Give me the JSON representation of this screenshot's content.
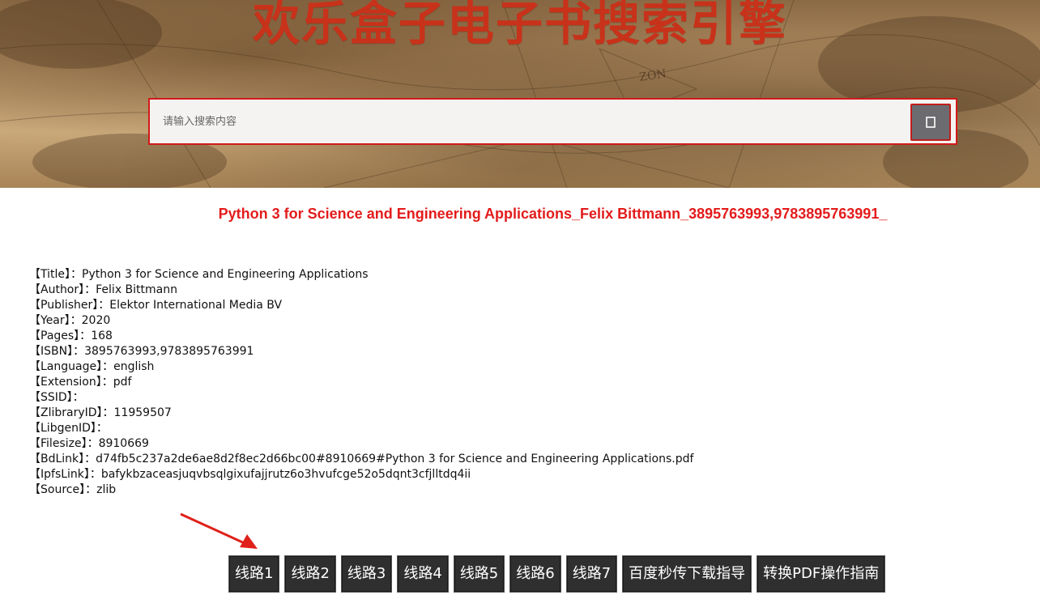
{
  "header": {
    "site_title": "欢乐盒子电子书搜索引擎",
    "search_placeholder": "请输入搜索内容",
    "search_icon": "search-icon"
  },
  "book": {
    "heading": "Python 3 for Science and Engineering Applications_Felix Bittmann_3895763993,9783895763991_",
    "details": [
      {
        "label": "【Title】：",
        "value": "Python 3 for Science and Engineering Applications"
      },
      {
        "label": "【Author】：",
        "value": "Felix Bittmann"
      },
      {
        "label": "【Publisher】：",
        "value": "Elektor International Media BV"
      },
      {
        "label": "【Year】：",
        "value": "2020"
      },
      {
        "label": "【Pages】：",
        "value": "168"
      },
      {
        "label": "【ISBN】：",
        "value": "3895763993,9783895763991"
      },
      {
        "label": "【Language】：",
        "value": "english"
      },
      {
        "label": "【Extension】：",
        "value": "pdf"
      },
      {
        "label": "【SSID】：",
        "value": ""
      },
      {
        "label": "【ZlibraryID】：",
        "value": "11959507"
      },
      {
        "label": "【LibgenID】：",
        "value": ""
      },
      {
        "label": "【Filesize】：",
        "value": "8910669"
      },
      {
        "label": "【BdLink】：",
        "value": "d74fb5c237a2de6ae8d2f8ec2d66bc00#8910669#Python 3 for Science and Engineering Applications.pdf"
      },
      {
        "label": "【IpfsLink】：",
        "value": "bafykbzaceasjuqvbsqlgixufajjrutz6o3hvufcge52o5dqnt3cfjlltdq4ii"
      },
      {
        "label": "【Source】：",
        "value": "zlib"
      }
    ]
  },
  "buttons": [
    "线路1",
    "线路2",
    "线路3",
    "线路4",
    "线路5",
    "线路6",
    "线路7",
    "百度秒传下载指导",
    "转换PDF操作指南"
  ],
  "colors": {
    "title": "#c8321a",
    "heading": "#e31b1b",
    "search_border": "#d11a1a",
    "button_bg": "#2f2f2f",
    "arrow": "#e0201a"
  }
}
